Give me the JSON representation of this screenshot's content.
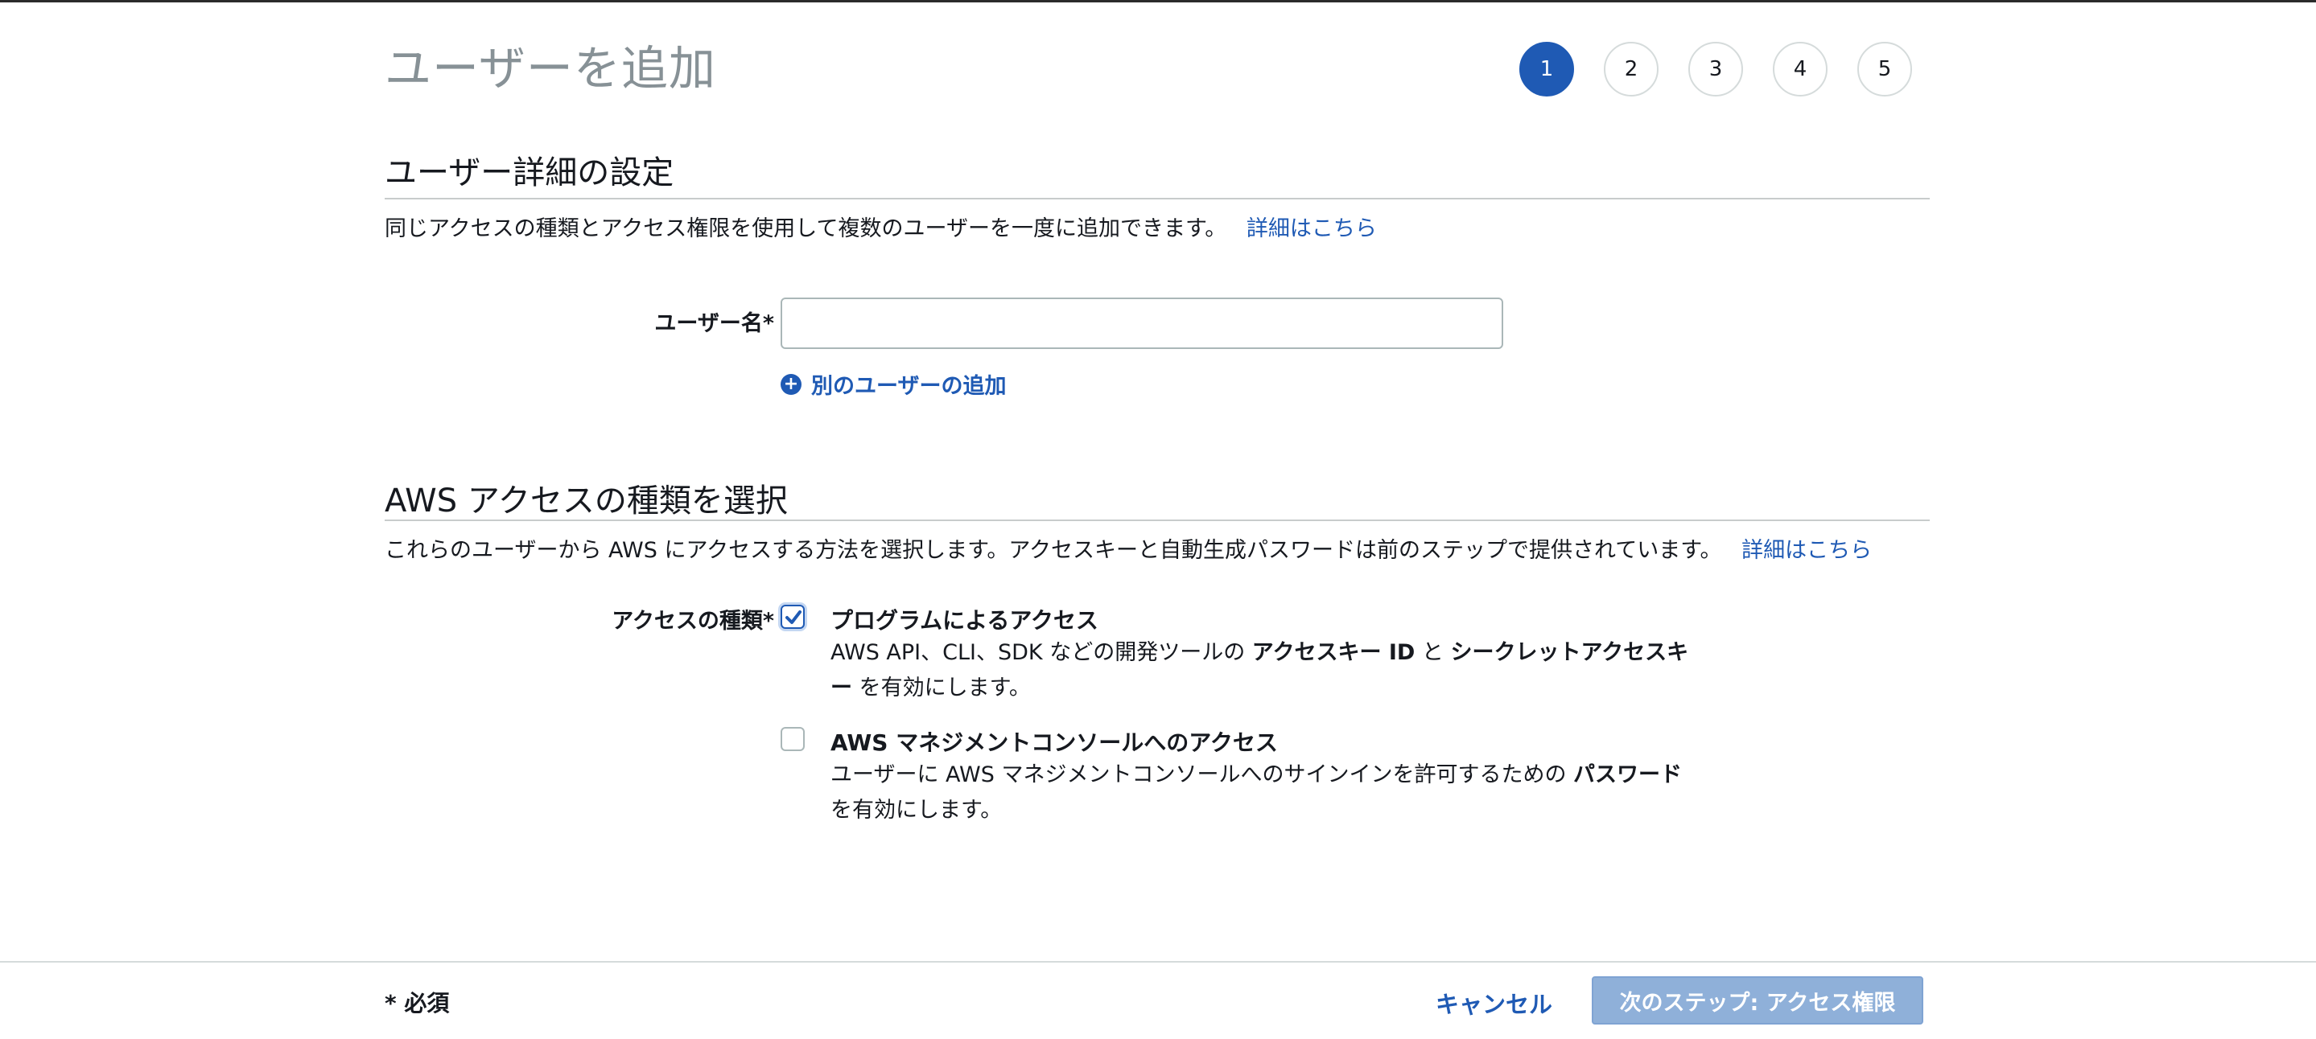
{
  "page": {
    "title": "ユーザーを追加"
  },
  "steps": [
    "1",
    "2",
    "3",
    "4",
    "5"
  ],
  "active_step": "1",
  "user_details": {
    "title": "ユーザー詳細の設定",
    "description": "同じアクセスの種類とアクセス権限を使用して複数のユーザーを一度に追加できます。",
    "learn_more": "詳細はこちら",
    "username_label": "ユーザー名*",
    "username_value": "",
    "add_user_link": "別のユーザーの追加"
  },
  "access_type": {
    "title": "AWS アクセスの種類を選択",
    "description": "これらのユーザーから AWS にアクセスする方法を選択します。アクセスキーと自動生成パスワードは前のステップで提供されています。",
    "learn_more": "詳細はこちら",
    "label": "アクセスの種類*",
    "options": [
      {
        "title": "プログラムによるアクセス",
        "checked": true,
        "desc_prefix": "AWS API、CLI、SDK などの開発ツールの ",
        "desc_bold1": "アクセスキー ID",
        "desc_mid": " と ",
        "desc_bold2": "シークレットアクセスキー",
        "desc_suffix": " を有効にします。"
      },
      {
        "title": "AWS マネジメントコンソールへのアクセス",
        "checked": false,
        "desc_prefix": "ユーザーに AWS マネジメントコンソールへのサインインを許可するための ",
        "desc_bold1": "パスワード",
        "desc_suffix": " を有効にします。"
      }
    ]
  },
  "footer": {
    "required_note": "* 必須",
    "cancel_label": "キャンセル",
    "next_label": "次のステップ: アクセス権限"
  },
  "colors": {
    "link": "#1f5ab4",
    "active_step": "#1f5ab4",
    "next_button_disabled": "#8fb0d9"
  }
}
